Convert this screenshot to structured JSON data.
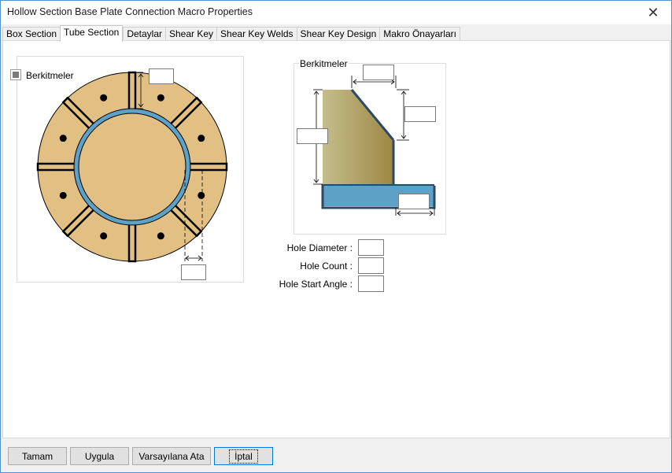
{
  "window": {
    "title": "Hollow Section Base Plate Connection Macro Properties",
    "close_glyph": "✕"
  },
  "tabs": [
    {
      "label": "Box Section",
      "active": false
    },
    {
      "label": "Tube Section",
      "active": true
    },
    {
      "label": "Detaylar",
      "active": false
    },
    {
      "label": "Shear Key",
      "active": false
    },
    {
      "label": "Shear Key Welds",
      "active": false
    },
    {
      "label": "Shear Key Design",
      "active": false
    },
    {
      "label": "Makro Önayarları",
      "active": false
    }
  ],
  "stiffeners_check": {
    "label": "Berkitmeler",
    "state": "indeterminate"
  },
  "stiffener_group": {
    "label": "Berkitmeler"
  },
  "properties": {
    "hole_diameter": {
      "label": "Hole Diameter :",
      "value": ""
    },
    "hole_count": {
      "label": "Hole Count :",
      "value": ""
    },
    "hole_start_angle": {
      "label": "Hole Start Angle :",
      "value": ""
    }
  },
  "buttons": {
    "ok": "Tamam",
    "apply": "Uygula",
    "defaults": "Varsayılana Ata",
    "cancel": "İptal"
  },
  "colors": {
    "plate": "#e2c083",
    "tube": "#5ea1c6",
    "stiffener_light": "#c4bd8b",
    "stiffener_dark": "#9e8745",
    "accent": "#0078d7"
  }
}
